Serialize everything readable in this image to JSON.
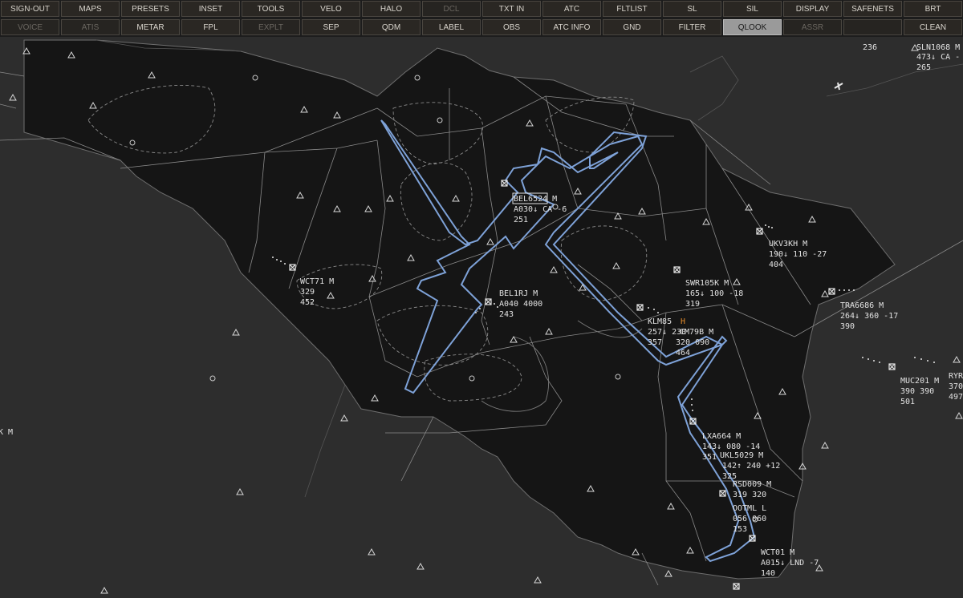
{
  "toolbar": {
    "row1": [
      "SIGN-OUT",
      "MAPS",
      "PRESETS",
      "INSET",
      "TOOLS",
      "VELO",
      "HALO",
      "DCL",
      "TXT IN",
      "ATC",
      "FLTLIST",
      "SL",
      "SIL",
      "DISPLAY",
      "SAFENETS",
      "BRT"
    ],
    "row2": [
      "VOICE",
      "ATIS",
      "METAR",
      "FPL",
      "EXPLT",
      "SEP",
      "QDM",
      "LABEL",
      "OBS",
      "ATC INFO",
      "GND",
      "FILTER",
      "QLOOK",
      "ASSR",
      "",
      "CLEAN"
    ],
    "dim_row1": [
      "DCL"
    ],
    "dim_row2": [
      "VOICE",
      "ATIS",
      "EXPLT",
      "ASSR"
    ],
    "active": "QLOOK"
  },
  "colors": {
    "background": "#2d2d2d",
    "sector_fill": "#141414",
    "route": "#7ea2d8",
    "label": "#e2e2e2",
    "warning": "#e08a2c"
  },
  "map": {
    "corner_text": "236",
    "left_edge_text": "K M",
    "tracks": [
      {
        "callsign": "SLN1068 M",
        "line2": "473↓ CA -",
        "line3": "265"
      },
      {
        "callsign": "BEL6524 M",
        "line2": "A030↓ CA -6",
        "line3": "251"
      },
      {
        "callsign": "UKV3KH M",
        "line2": "190↓ 110 -27",
        "line3": "404"
      },
      {
        "callsign": "WCT71 M",
        "line2": "329",
        "line3": "452"
      },
      {
        "callsign": "SWR105K M",
        "line2": "165↓ 100 -18",
        "line3": "319"
      },
      {
        "callsign": "BEL1RJ M",
        "line2": "A040 4000",
        "line3": "243"
      },
      {
        "callsign": "TRA6686 M",
        "line2": "264↓ 360 -17",
        "line3": "390"
      },
      {
        "callsign": "KLM85",
        "line2": "257↓ 230",
        "line3": "357",
        "marker": "H"
      },
      {
        "callsign": "CM79B M",
        "line2": "320 090",
        "line3": "464"
      },
      {
        "callsign": "MUC201 M",
        "line2": "390 390",
        "line3": "501"
      },
      {
        "callsign": "RYR",
        "line2": "370",
        "line3": "497"
      },
      {
        "callsign": "LXA664 M",
        "line2": "143↓ 080 -14",
        "line3": "351"
      },
      {
        "callsign": "UKL5029 M",
        "line2": "142↑ 240 +12",
        "line3": "325"
      },
      {
        "callsign": "RSD009 M",
        "line2": "319 320",
        "line3": ""
      },
      {
        "callsign": "OOTML L",
        "line2": "056 060",
        "line3": "153"
      },
      {
        "callsign": "WCT01 M",
        "line2": "A015↓ LND -7",
        "line3": "140"
      }
    ]
  }
}
